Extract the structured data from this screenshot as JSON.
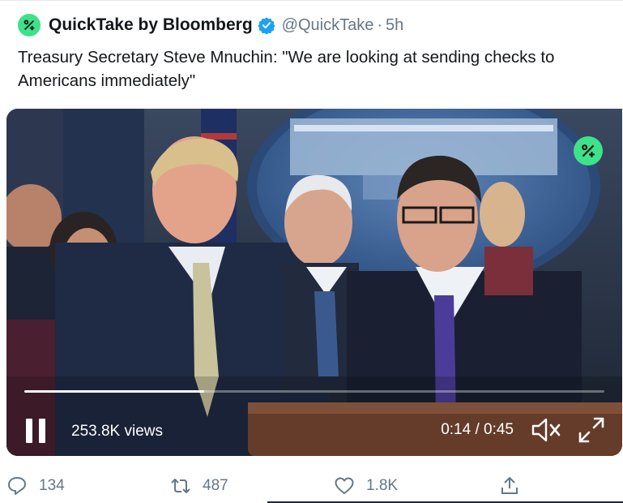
{
  "tweet": {
    "account_name": "QuickTake by Bloomberg",
    "handle": "@QuickTake",
    "separator": "·",
    "time": "5h",
    "text": "Treasury Secretary Steve Mnuchin: \"We are looking at sending checks to Americans immediately\""
  },
  "video": {
    "views": "253.8K views",
    "timecode": "0:14 / 0:45",
    "progress": 0.31,
    "controls": {
      "pause_icon": "pause-icon",
      "mute_icon": "volume-muted-icon",
      "fullscreen_icon": "fullscreen-icon"
    }
  },
  "actions": {
    "reply_count": "134",
    "retweet_count": "487",
    "like_count": "1.8K"
  },
  "colors": {
    "brand_green": "#3ee289",
    "verified_blue": "#1da1f2",
    "muted_text": "#657786"
  }
}
